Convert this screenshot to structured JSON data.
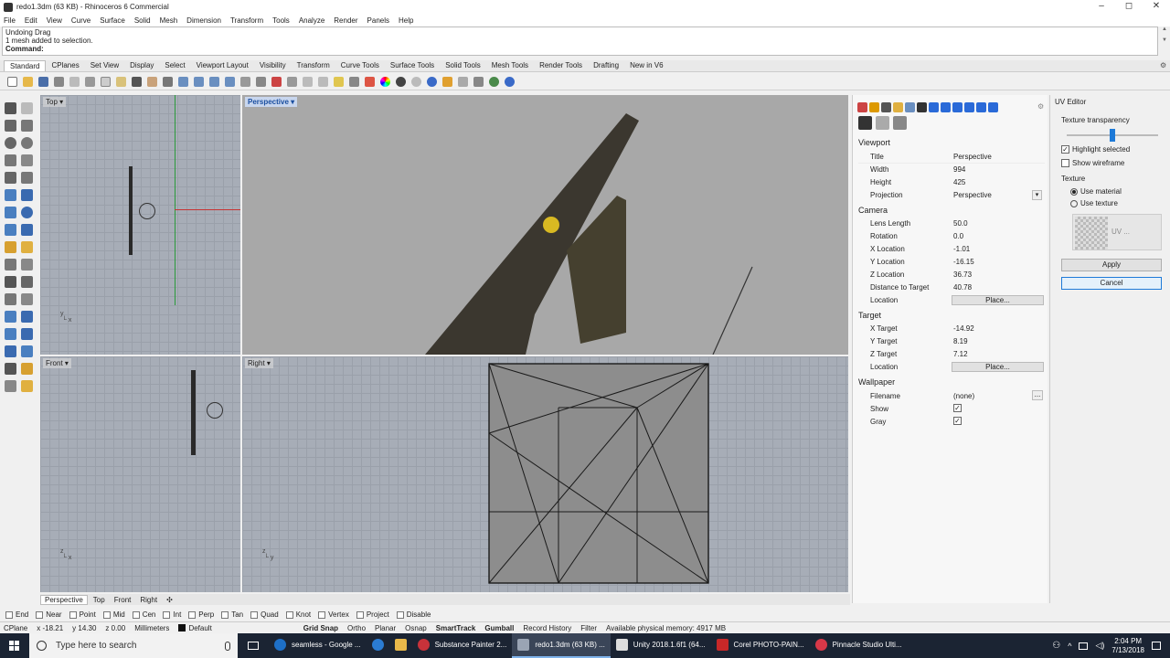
{
  "window": {
    "title": "redo1.3dm (63 KB) - Rhinoceros 6 Commercial",
    "min": "–",
    "max": "◻",
    "close": "✕"
  },
  "menu": [
    "File",
    "Edit",
    "View",
    "Curve",
    "Surface",
    "Solid",
    "Mesh",
    "Dimension",
    "Transform",
    "Tools",
    "Analyze",
    "Render",
    "Panels",
    "Help"
  ],
  "command": {
    "history": [
      "Undoing Drag",
      "1 mesh added to selection."
    ],
    "prompt": "Command:"
  },
  "toolbar_tabs": [
    "Standard",
    "CPlanes",
    "Set View",
    "Display",
    "Select",
    "Viewport Layout",
    "Visibility",
    "Transform",
    "Curve Tools",
    "Surface Tools",
    "Solid Tools",
    "Mesh Tools",
    "Render Tools",
    "Drafting",
    "New in V6"
  ],
  "viewports": {
    "top": "Top",
    "perspective": "Perspective",
    "front": "Front",
    "right": "Right"
  },
  "viewport_tabs": [
    "Perspective",
    "Top",
    "Front",
    "Right",
    "✣"
  ],
  "properties": {
    "viewport_heading": "Viewport",
    "viewport": [
      {
        "label": "Title",
        "value": "Perspective"
      },
      {
        "label": "Width",
        "value": "994"
      },
      {
        "label": "Height",
        "value": "425"
      },
      {
        "label": "Projection",
        "value": "Perspective"
      }
    ],
    "camera_heading": "Camera",
    "camera": [
      {
        "label": "Lens Length",
        "value": "50.0"
      },
      {
        "label": "Rotation",
        "value": "0.0"
      },
      {
        "label": "X Location",
        "value": "-1.01"
      },
      {
        "label": "Y Location",
        "value": "-16.15"
      },
      {
        "label": "Z Location",
        "value": "36.73"
      },
      {
        "label": "Distance to Target",
        "value": "40.78"
      }
    ],
    "camera_location_label": "Location",
    "place_label": "Place...",
    "target_heading": "Target",
    "target": [
      {
        "label": "X Target",
        "value": "-14.92"
      },
      {
        "label": "Y Target",
        "value": "8.19"
      },
      {
        "label": "Z Target",
        "value": "7.12"
      }
    ],
    "target_location_label": "Location",
    "wallpaper_heading": "Wallpaper",
    "filename_label": "Filename",
    "filename_value": "(none)",
    "browse": "...",
    "show_label": "Show",
    "gray_label": "Gray"
  },
  "uv_editor": {
    "title": "UV Editor",
    "transparency": "Texture transparency",
    "transparency_level": 0.5,
    "highlight": "Highlight selected",
    "wireframe": "Show wireframe",
    "texture": "Texture",
    "use_material": "Use material",
    "use_texture": "Use texture",
    "uv_label": "UV ...",
    "apply": "Apply",
    "cancel": "Cancel"
  },
  "osnaps": [
    "End",
    "Near",
    "Point",
    "Mid",
    "Cen",
    "Int",
    "Perp",
    "Tan",
    "Quad",
    "Knot",
    "Vertex",
    "Project",
    "Disable"
  ],
  "status": {
    "cplane": "CPlane",
    "x": "x -18.21",
    "y": "y 14.30",
    "z": "z 0.00",
    "units": "Millimeters",
    "layer": "Default",
    "grid_snap": "Grid Snap",
    "ortho": "Ortho",
    "planar": "Planar",
    "osnap": "Osnap",
    "smarttrack": "SmartTrack",
    "gumball": "Gumball",
    "record": "Record History",
    "filter": "Filter",
    "memory": "Available physical memory: 4917 MB"
  },
  "taskbar": {
    "search": "Type here to search",
    "apps": [
      {
        "label": "seamless - Google ..."
      },
      {
        "label": "Substance Painter 2..."
      },
      {
        "label": "redo1.3dm (63 KB) ..."
      },
      {
        "label": "Unity 2018.1.6f1 (64..."
      },
      {
        "label": "Corel PHOTO-PAIN..."
      },
      {
        "label": "Pinnacle Studio Ulti..."
      }
    ],
    "time": "2:04 PM",
    "date": "7/13/2018"
  }
}
